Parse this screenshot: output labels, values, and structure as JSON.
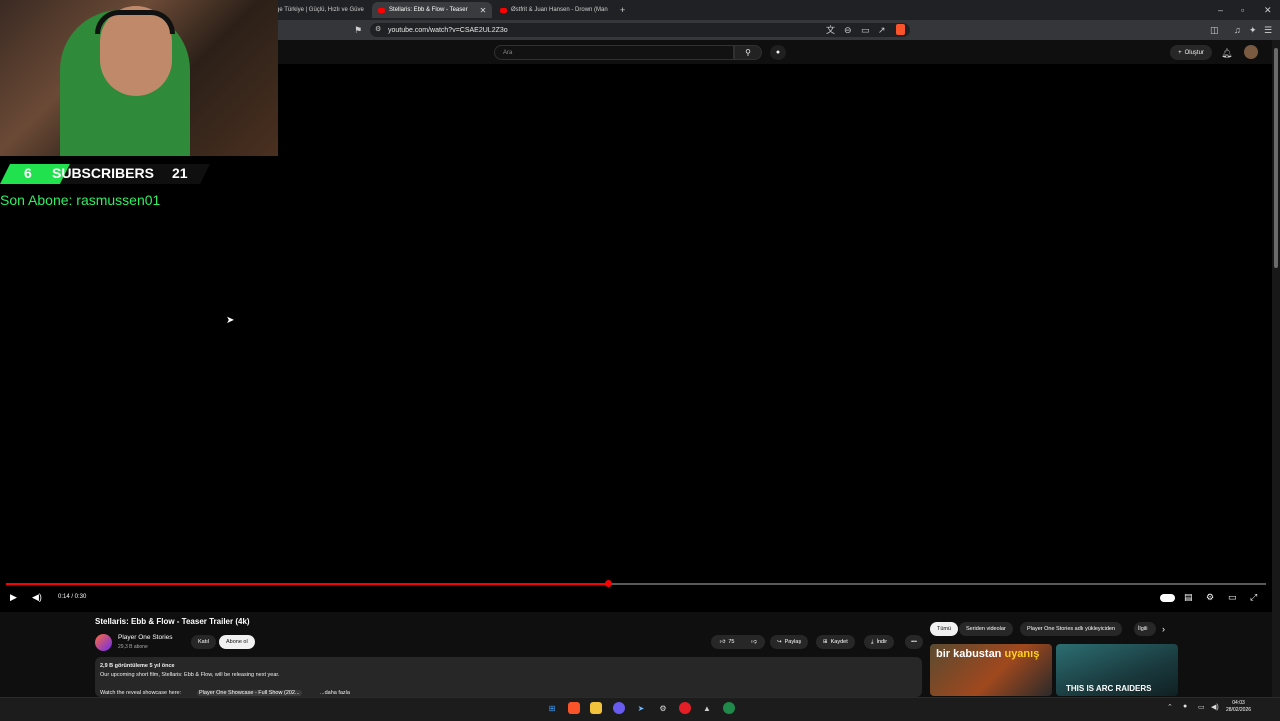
{
  "browser": {
    "tabs": [
      {
        "label": "ge Türkiye | Güçlü, Hızlı ve Güve"
      },
      {
        "label": "Stellaris: Ebb & Flow - Teaser"
      },
      {
        "label": "Østfrit & Juan Hansen - Drown (Man"
      }
    ],
    "new_tab": "+",
    "url": "youtube.com/watch?v=CSAE2UL2Z3o"
  },
  "youtube": {
    "search_placeholder": "Ara",
    "create_label": "Oluştur"
  },
  "overlay": {
    "sub_left": "6",
    "sub_label": "SUBSCRIBERS",
    "sub_right": "21",
    "last_sub": "Son Abone: rasmussen01"
  },
  "player": {
    "time": "0:14 / 0:30",
    "progress": 0.478,
    "colors": {
      "progress": "#ff0000"
    }
  },
  "video": {
    "title": "Stellaris: Ebb & Flow - Teaser Trailer (4k)",
    "channel": "Player One Stories",
    "channel_subs": "29,3 B abone",
    "join_label": "Katıl",
    "subscribe_label": "Abone ol",
    "like_count": "75",
    "share_label": "Paylaş",
    "save_label": "Kaydet",
    "download_label": "İndir",
    "views_line": "2,9 B görüntüleme  5 yıl önce",
    "desc_line1": "Our upcoming short film, Stellaris: Ebb & Flow, will be releasing next year.",
    "desc_line2": "Watch the reveal showcase here:",
    "desc_link": "Player One Showcase - Full Show (202...",
    "desc_more": "...daha fazla"
  },
  "chips": [
    {
      "label": "Tümü"
    },
    {
      "label": "Seriden videolar"
    },
    {
      "label": "Player One Stories adlı yükleyiciden"
    },
    {
      "label": "İlgili"
    }
  ],
  "thumbs": [
    {
      "text_a": "bir kabustan ",
      "text_b": "uyanış"
    },
    {
      "text": "THIS IS ARC RAIDERS"
    }
  ],
  "taskbar": {
    "time": "04:03",
    "date": "28/02/2026"
  }
}
